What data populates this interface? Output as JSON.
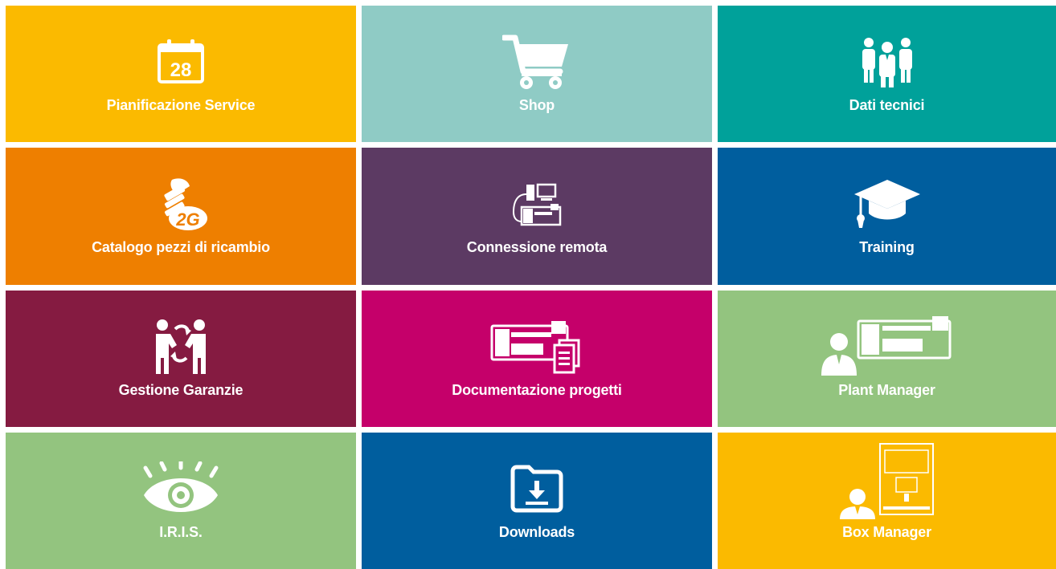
{
  "tiles": [
    {
      "label": "Pianificazione Service",
      "icon": "calendar-icon",
      "calendar_day": "28",
      "color": "#FBBA00"
    },
    {
      "label": "Shop",
      "icon": "shopping-cart-icon",
      "color": "#8FCBC5"
    },
    {
      "label": "Dati tecnici",
      "icon": "people-group-icon",
      "color": "#00A19A"
    },
    {
      "label": "Catalogo pezzi di ricambio",
      "icon": "screw-spare-part-icon",
      "badge": "2G",
      "color": "#EE7F00"
    },
    {
      "label": "Connessione remota",
      "icon": "remote-connection-icon",
      "color": "#5C3A63"
    },
    {
      "label": "Training",
      "icon": "graduation-cap-icon",
      "color": "#005E9E"
    },
    {
      "label": "Gestione Garanzie",
      "icon": "warranty-exchange-icon",
      "color": "#851B41"
    },
    {
      "label": "Documentazione progetti",
      "icon": "machine-documents-icon",
      "color": "#C5006A"
    },
    {
      "label": "Plant Manager",
      "icon": "plant-manager-icon",
      "color": "#93C47F"
    },
    {
      "label": "I.R.I.S.",
      "icon": "eye-icon",
      "color": "#93C47F"
    },
    {
      "label": "Downloads",
      "icon": "download-folder-icon",
      "color": "#005E9E"
    },
    {
      "label": "Box Manager",
      "icon": "box-manager-icon",
      "color": "#FBBA00"
    }
  ]
}
